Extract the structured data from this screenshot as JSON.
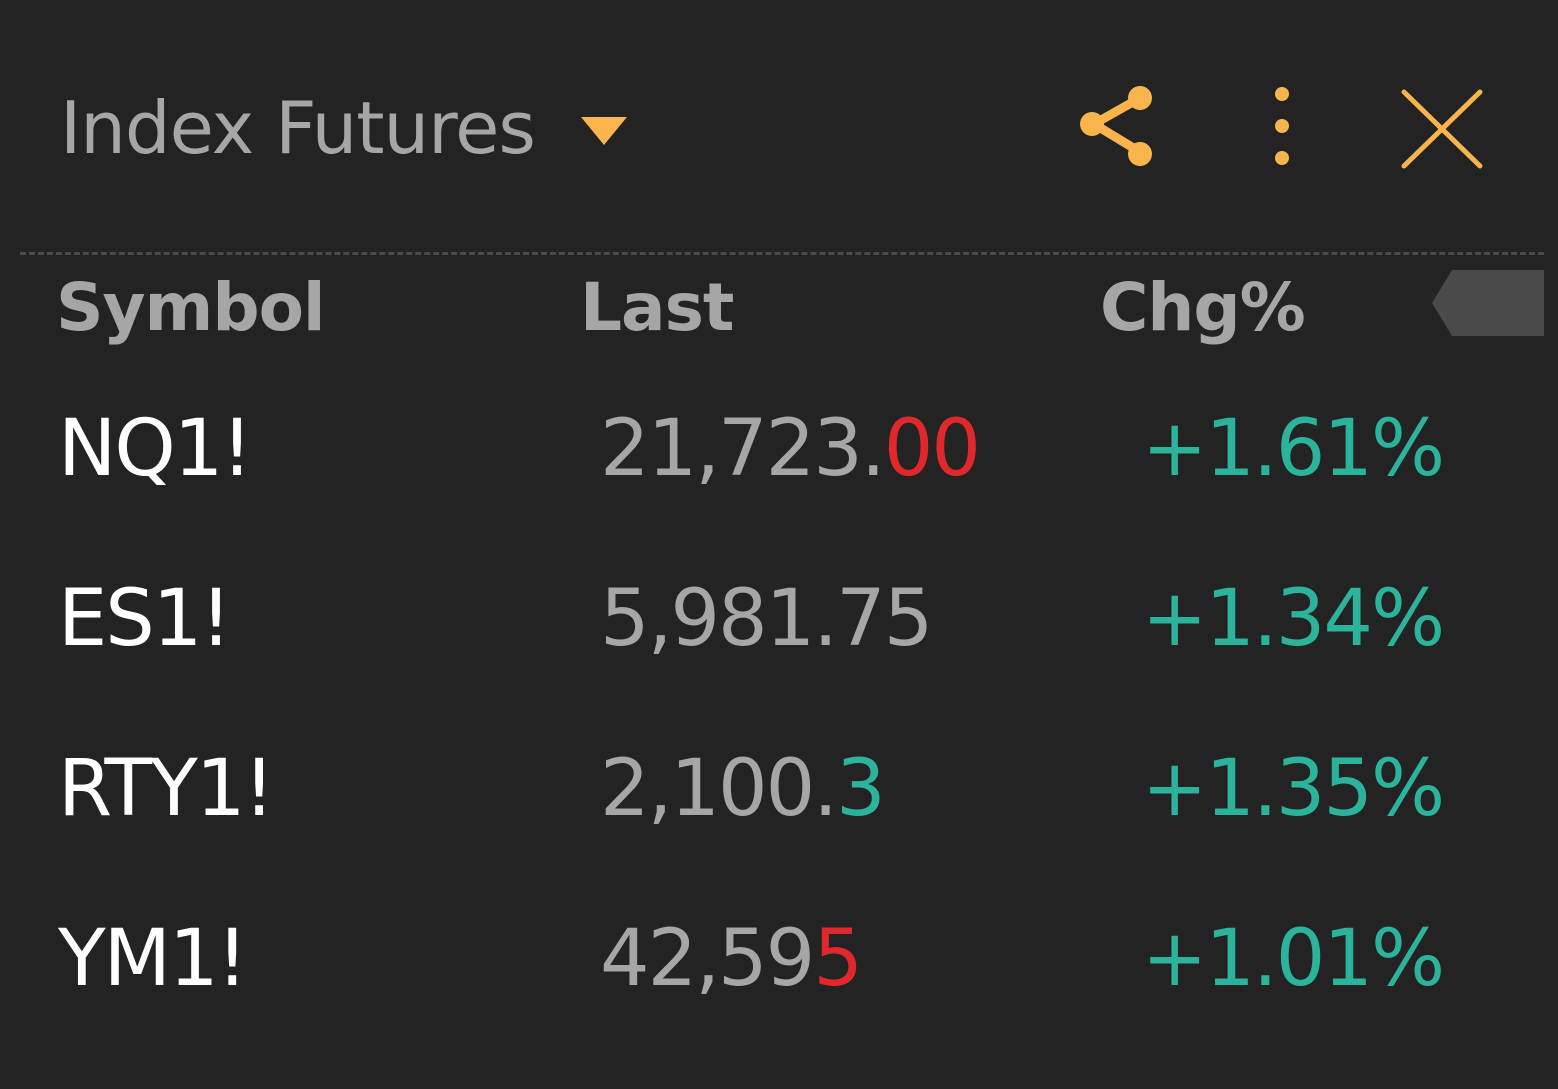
{
  "colors": {
    "background": "#232323",
    "accent": "#f9b54c",
    "title_text": "#a6a6a6",
    "symbol_text": "#ffffff",
    "price_text": "#a6a6a6",
    "positive": "#2bb49b",
    "negative": "#e0282c"
  },
  "header": {
    "title": "Index Futures",
    "caret_icon": "triangle-down-icon",
    "share_icon": "share-icon",
    "more_icon": "more-vertical-icon",
    "close_icon": "close-icon"
  },
  "table": {
    "columns": {
      "symbol": "Symbol",
      "last": "Last",
      "chg": "Chg%"
    },
    "collapse_icon": "collapse-tab-icon",
    "rows": [
      {
        "symbol": "NQ1!",
        "last_base": "21,723.",
        "last_highlight": "00",
        "highlight": "red",
        "chg": "+1.61%"
      },
      {
        "symbol": "ES1!",
        "last_base": "5,981.75",
        "last_highlight": "",
        "highlight": "none",
        "chg": "+1.34%"
      },
      {
        "symbol": "RTY1!",
        "last_base": "2,100.",
        "last_highlight": "3",
        "highlight": "green",
        "chg": "+1.35%"
      },
      {
        "symbol": "YM1!",
        "last_base": "42,59",
        "last_highlight": "5",
        "highlight": "red",
        "chg": "+1.01%"
      }
    ]
  }
}
